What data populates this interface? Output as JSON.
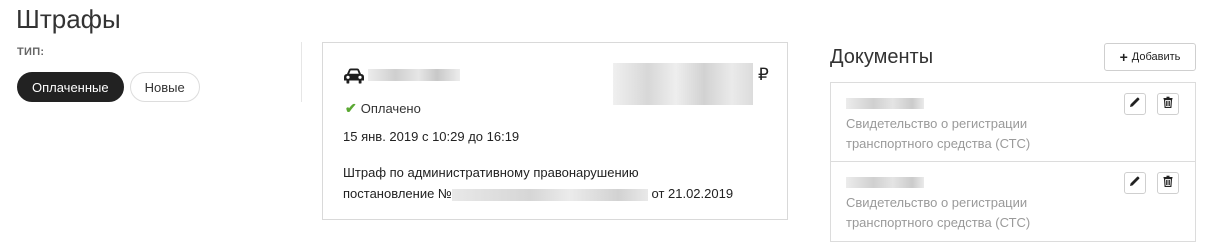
{
  "page": {
    "title": "Штрафы"
  },
  "filters": {
    "label": "ТИП:",
    "options": [
      {
        "label": "Оплаченные",
        "active": true
      },
      {
        "label": "Новые",
        "active": false
      }
    ]
  },
  "fine": {
    "currency": "₽",
    "status": "Оплачено",
    "date": "15 янв. 2019 с 10:29 до 16:19",
    "description_line1": "Штраф по административному правонарушению",
    "ruling_prefix": "постановление №",
    "ruling_suffix": "от 21.02.2019",
    "icon": "car-icon",
    "status_color": "#5aa832"
  },
  "documents": {
    "title": "Документы",
    "add_label": "Добавить",
    "items": [
      {
        "type": "Свидетельство о регистрации транспортного средства (СТС)"
      },
      {
        "type": "Свидетельство о регистрации транспортного средства (СТС)"
      }
    ]
  }
}
